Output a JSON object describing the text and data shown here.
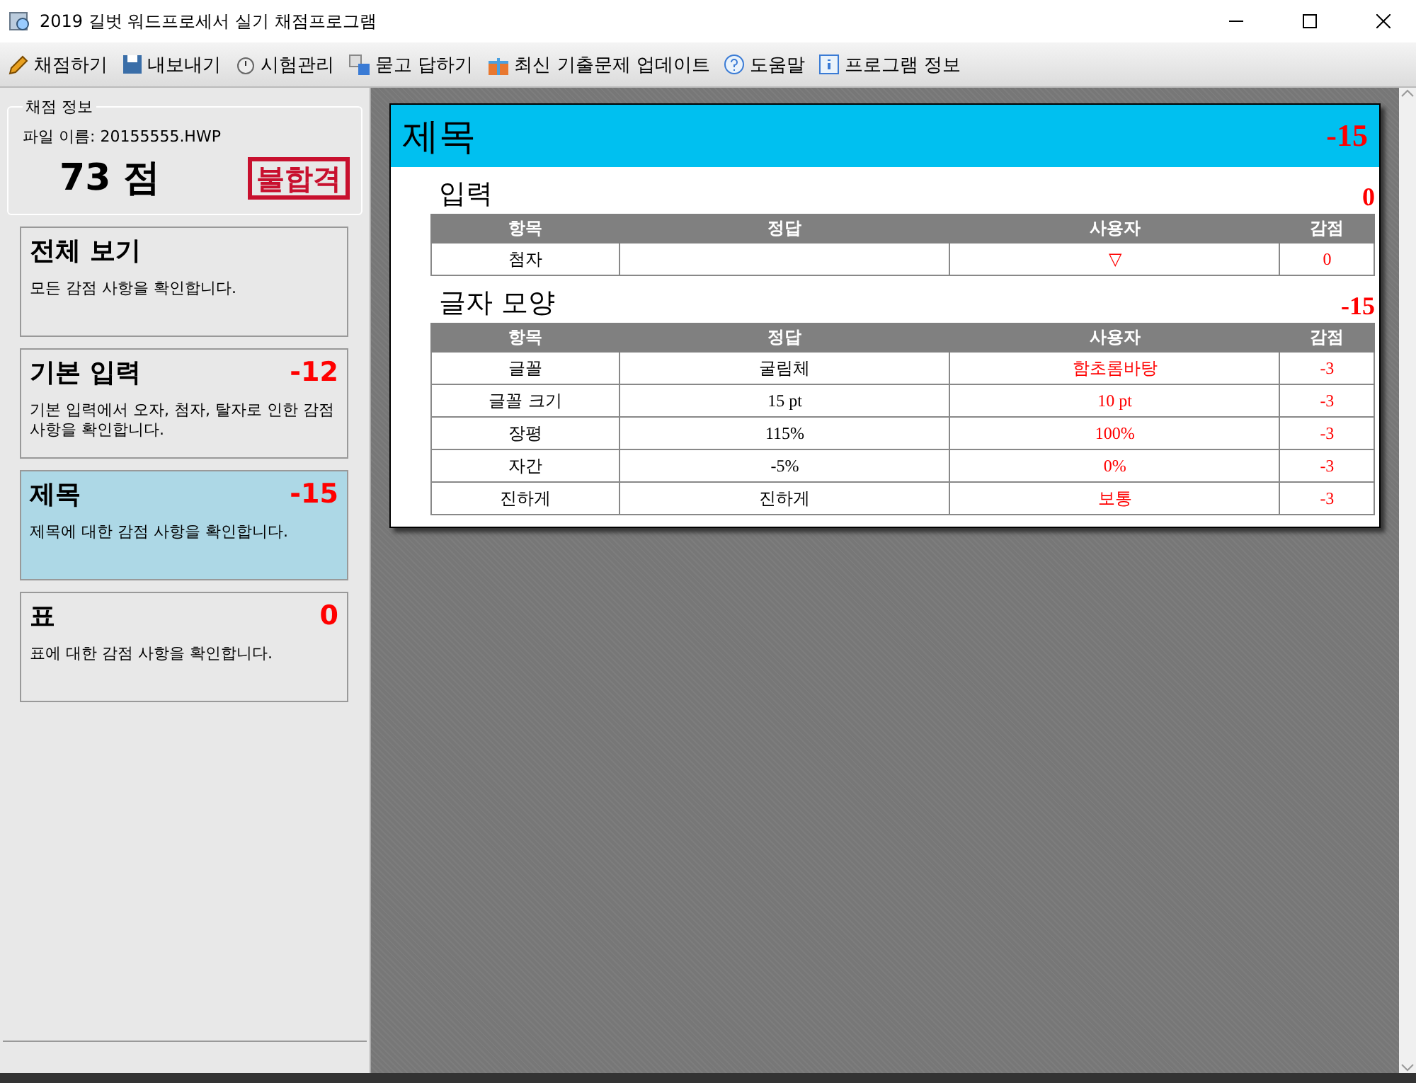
{
  "window": {
    "title": "2019 길벗 워드프로세서 실기 채점프로그램"
  },
  "toolbar": [
    {
      "label": "채점하기"
    },
    {
      "label": "내보내기"
    },
    {
      "label": "시험관리"
    },
    {
      "label": "묻고 답하기"
    },
    {
      "label": "최신 기출문제 업데이트"
    },
    {
      "label": "도움말"
    },
    {
      "label": "프로그램 정보"
    }
  ],
  "score_info": {
    "legend": "채점 정보",
    "file_name": "파일 이름: 20155555.HWP",
    "score": "73 점",
    "stamp": "불합격"
  },
  "categories": [
    {
      "title": "전체 보기",
      "description": "모든 감점 사항을 확인합니다.",
      "selected": false
    },
    {
      "title": "기본 입력",
      "points": "-12",
      "description": "기본 입력에서 오자, 첨자, 탈자로 인한 감점 사항을 확인합니다.",
      "selected": false
    },
    {
      "title": "제목",
      "points": "-15",
      "description": "제목에 대한 감점 사항을 확인합니다.",
      "selected": true
    },
    {
      "title": "표",
      "points": "0",
      "description": "표에 대한 감점 사항을 확인합니다.",
      "selected": false
    }
  ],
  "report": {
    "title": "제목",
    "points": "-15",
    "sections": [
      {
        "title": "입력",
        "points": "0",
        "columns": [
          "항목",
          "정답",
          "사용자",
          "감점"
        ],
        "rows": [
          {
            "item": "첨자",
            "user": "▽",
            "deduction": "0"
          }
        ]
      },
      {
        "title": "글자 모양",
        "points": "-15",
        "columns": [
          "항목",
          "정답",
          "사용자",
          "감점"
        ],
        "rows": [
          {
            "item": "글꼴",
            "answer": "굴림체",
            "user": "함초롬바탕",
            "deduction": "-3"
          },
          {
            "item": "글꼴 크기",
            "answer": "15 pt",
            "user": "10 pt",
            "deduction": "-3"
          },
          {
            "item": "장평",
            "answer": "115%",
            "user": "100%",
            "deduction": "-3"
          },
          {
            "item": "자간",
            "answer": "-5%",
            "user": "0%",
            "deduction": "-3"
          },
          {
            "item": "진하게",
            "answer": "진하게",
            "user": "보통",
            "deduction": "-3"
          }
        ]
      }
    ]
  }
}
